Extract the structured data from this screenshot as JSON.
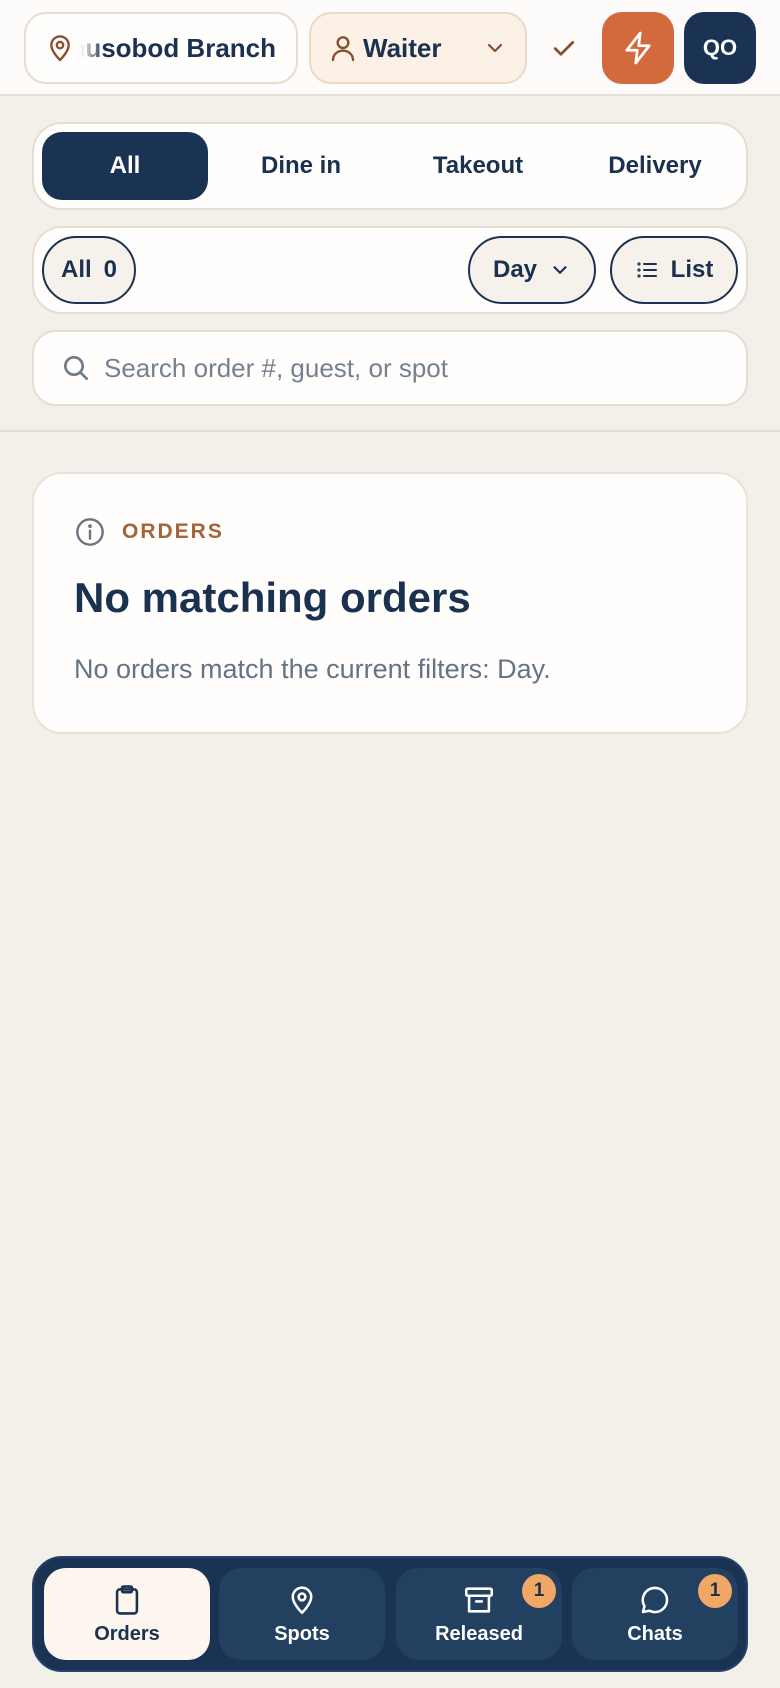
{
  "header": {
    "branch_name": "Yunusobod Branch",
    "role": "Waiter",
    "avatar_initials": "QO"
  },
  "order_type_tabs": [
    {
      "label": "All",
      "active": true
    },
    {
      "label": "Dine in",
      "active": false
    },
    {
      "label": "Takeout",
      "active": false
    },
    {
      "label": "Delivery",
      "active": false
    }
  ],
  "filters": {
    "status_label": "All",
    "status_count": "0",
    "period_label": "Day",
    "view_label": "List"
  },
  "search": {
    "placeholder": "Search order #, guest, or spot",
    "value": ""
  },
  "empty_state": {
    "eyebrow": "ORDERS",
    "title": "No matching orders",
    "message": "No orders match the current filters: Day."
  },
  "bottom_nav": [
    {
      "label": "Orders",
      "icon": "clipboard-icon",
      "active": true
    },
    {
      "label": "Spots",
      "icon": "map-pin-icon",
      "active": false
    },
    {
      "label": "Released",
      "icon": "archive-icon",
      "active": false,
      "badge": "1"
    },
    {
      "label": "Chats",
      "icon": "chat-bubble-icon",
      "active": false,
      "badge": "1"
    }
  ],
  "colors": {
    "navy": "#1b3352",
    "accent_orange": "#d26a3e",
    "eyebrow_brown": "#a5633c",
    "badge": "#f1a866",
    "background": "#f3f0ea"
  }
}
